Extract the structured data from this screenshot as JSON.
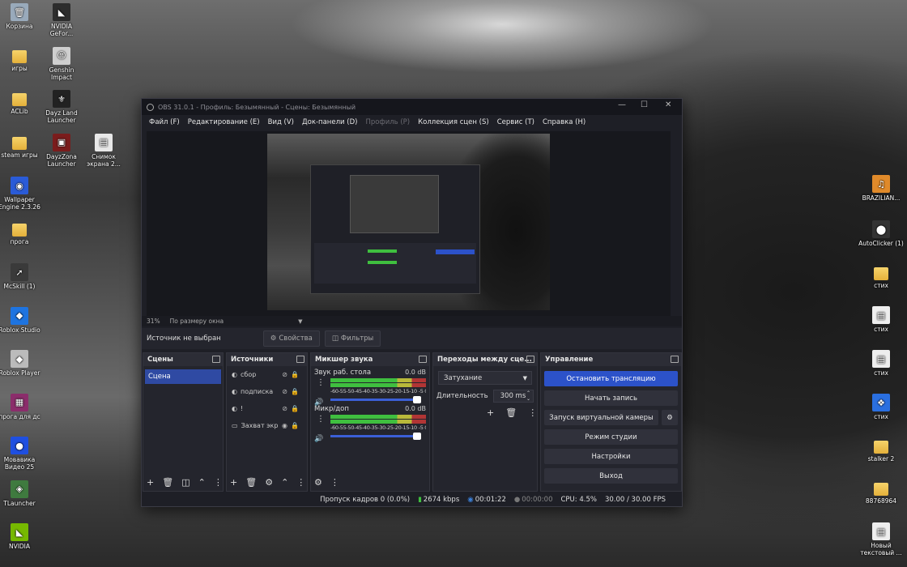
{
  "desktop": {
    "left_icons": [
      {
        "label": "Корзина",
        "glyph": "🗑",
        "color": "#9ab"
      },
      {
        "label": "NVIDIA GeFor...",
        "glyph": "◣",
        "color": "#2d2d2d"
      },
      {
        "label": "игры",
        "glyph": "",
        "color": "folder"
      },
      {
        "label": "Genshin Impact",
        "glyph": "☺",
        "color": "#cfcfcf"
      },
      {
        "label": "ACLib",
        "glyph": "",
        "color": "folder"
      },
      {
        "label": "Dayz Land Launcher",
        "glyph": "⚜",
        "color": "#222"
      },
      {
        "label": "steam игры",
        "glyph": "",
        "color": "folder"
      },
      {
        "label": "DayzZona Launcher",
        "glyph": "▣",
        "color": "#7a1c1c"
      },
      {
        "label": "Снимок экрана 2...",
        "glyph": "▤",
        "color": "#e8e8e8"
      },
      {
        "label": "Wallpaper Engine 2.3.26",
        "glyph": "◉",
        "color": "#2a5bd7"
      },
      {
        "label": "прога",
        "glyph": "",
        "color": "folder"
      },
      {
        "label": "McSkill (1)",
        "glyph": "➚",
        "color": "#3a3a3a"
      },
      {
        "label": "Roblox Studio",
        "glyph": "◆",
        "color": "#1e74e0"
      },
      {
        "label": "Roblox Player",
        "glyph": "◆",
        "color": "#bbb"
      },
      {
        "label": "прога для дс",
        "glyph": "▦",
        "color": "#8b2d6b"
      },
      {
        "label": "Мовавика Видео 25",
        "glyph": "●",
        "color": "#1f4fe0"
      },
      {
        "label": "TLauncher",
        "glyph": "◈",
        "color": "#3f7a3f"
      },
      {
        "label": "NVIDIA",
        "glyph": "◣",
        "color": "#76b900"
      }
    ],
    "right_icons": [
      {
        "label": "BRAZILIAN...",
        "glyph": "♫",
        "color": "#e08a2a"
      },
      {
        "label": "AutoClicker (1)",
        "glyph": "⬤",
        "color": "#333"
      },
      {
        "label": "стих",
        "glyph": "",
        "color": "folder"
      },
      {
        "label": "стих",
        "glyph": "▤",
        "color": "#eee"
      },
      {
        "label": "стих",
        "glyph": "▤",
        "color": "#eee"
      },
      {
        "label": "стих",
        "glyph": "❖",
        "color": "#2a6fe0"
      },
      {
        "label": "stalker 2",
        "glyph": "",
        "color": "folder"
      },
      {
        "label": "88768964",
        "glyph": "",
        "color": "folder"
      },
      {
        "label": "Новый текстовый ...",
        "glyph": "▤",
        "color": "#eee"
      }
    ]
  },
  "window": {
    "title": "OBS 31.0.1 - Профиль: Безымянный - Сцены: Безымянный",
    "controls": {
      "minimize": "—",
      "maximize": "☐",
      "close": "✕"
    }
  },
  "menu": [
    {
      "label": "Файл (F)",
      "disabled": false
    },
    {
      "label": "Редактирование (E)",
      "disabled": false
    },
    {
      "label": "Вид (V)",
      "disabled": false
    },
    {
      "label": "Док-панели (D)",
      "disabled": false
    },
    {
      "label": "Профиль (P)",
      "disabled": true
    },
    {
      "label": "Коллекция сцен (S)",
      "disabled": false
    },
    {
      "label": "Сервис (T)",
      "disabled": false
    },
    {
      "label": "Справка (H)",
      "disabled": false
    }
  ],
  "zoom": {
    "value": "31%",
    "mode": "По размеру окна"
  },
  "source_bar": {
    "status": "Источник не выбран",
    "properties": "Свойства",
    "filters": "Фильтры"
  },
  "scenes": {
    "title": "Сцены",
    "items": [
      "Сцена"
    ]
  },
  "sources": {
    "title": "Источники",
    "items": [
      {
        "name": "сбор"
      },
      {
        "name": "подписка"
      },
      {
        "name": "!"
      },
      {
        "name": "Захват экр"
      }
    ]
  },
  "mixer": {
    "title": "Микшер звука",
    "channels": [
      {
        "name": "Звук раб. стола",
        "db": "0.0 dB"
      },
      {
        "name": "Микр/доп",
        "db": "0.0 dB"
      }
    ],
    "scale": "-60-55-50-45-40-35-30-25-20-15-10 -5  0"
  },
  "transitions": {
    "title": "Переходы между сце...",
    "selected": "Затухание",
    "duration_label": "Длительность",
    "duration_value": "300 ms"
  },
  "controls": {
    "title": "Управление",
    "stop_stream": "Остановить трансляцию",
    "start_record": "Начать запись",
    "virtual_cam": "Запуск виртуальной камеры",
    "studio_mode": "Режим студии",
    "settings": "Настройки",
    "exit": "Выход"
  },
  "status": {
    "dropped": "Пропуск кадров 0 (0.0%)",
    "bitrate": "2674 kbps",
    "stream_time": "00:01:22",
    "record_time": "00:00:00",
    "cpu": "CPU: 4.5%",
    "fps": "30.00 / 30.00 FPS"
  }
}
